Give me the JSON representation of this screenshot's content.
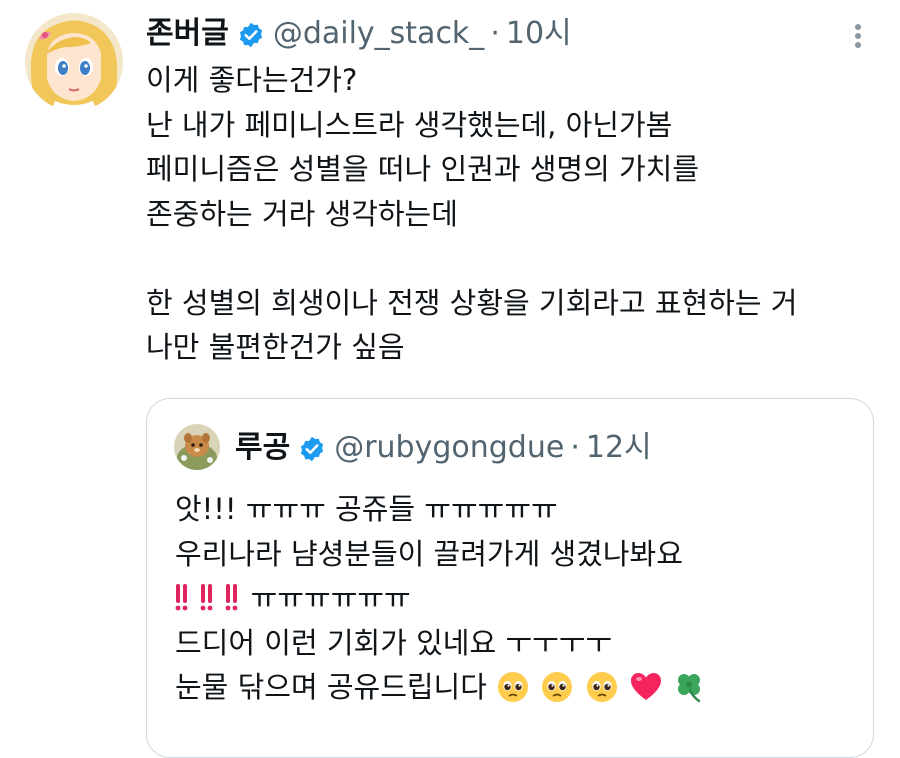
{
  "tweet": {
    "author": {
      "display_name": "존버글",
      "handle": "@daily_stack_",
      "verified": true
    },
    "separator": "·",
    "time": "10시",
    "more_icon": "more-vertical-icon",
    "lines": [
      "이게 좋다는건가?",
      "난 내가 페미니스트라 생각했는데, 아닌가봄",
      "페미니즘은 성별을 떠나 인권과 생명의 가치를",
      "존중하는 거라 생각하는데",
      "",
      "한 성별의 희생이나 전쟁 상황을 기회라고 표현하는 거",
      "나만 불편한건가 싶음"
    ]
  },
  "quote": {
    "author": {
      "display_name": "루공",
      "handle": "@rubygongdue",
      "verified": true
    },
    "separator": "·",
    "time": "12시",
    "line1": "앗!!! ㅠㅠㅠ 공쥬들 ㅠㅠㅠㅠㅠ",
    "line2": "우리나라 냠셩분들이 끌려가게 생겼나봐요",
    "line3_text": "ㅠㅠㅠㅠㅠㅠ",
    "line3_emoji": "double-exclamation-emoji x3",
    "line4": "드디어 이런 기회가 있네요 ㅜㅜㅜㅜ",
    "line5_text": "눈물 닦으며 공유드립니다",
    "line5_emoji": [
      "pleading-face-emoji",
      "pleading-face-emoji",
      "pleading-face-emoji",
      "red-heart-emoji",
      "four-leaf-clover-emoji"
    ]
  },
  "colors": {
    "text": "#0f1419",
    "secondary": "#536471",
    "verified_blue": "#1d9bf0",
    "border": "#cfd9de"
  }
}
